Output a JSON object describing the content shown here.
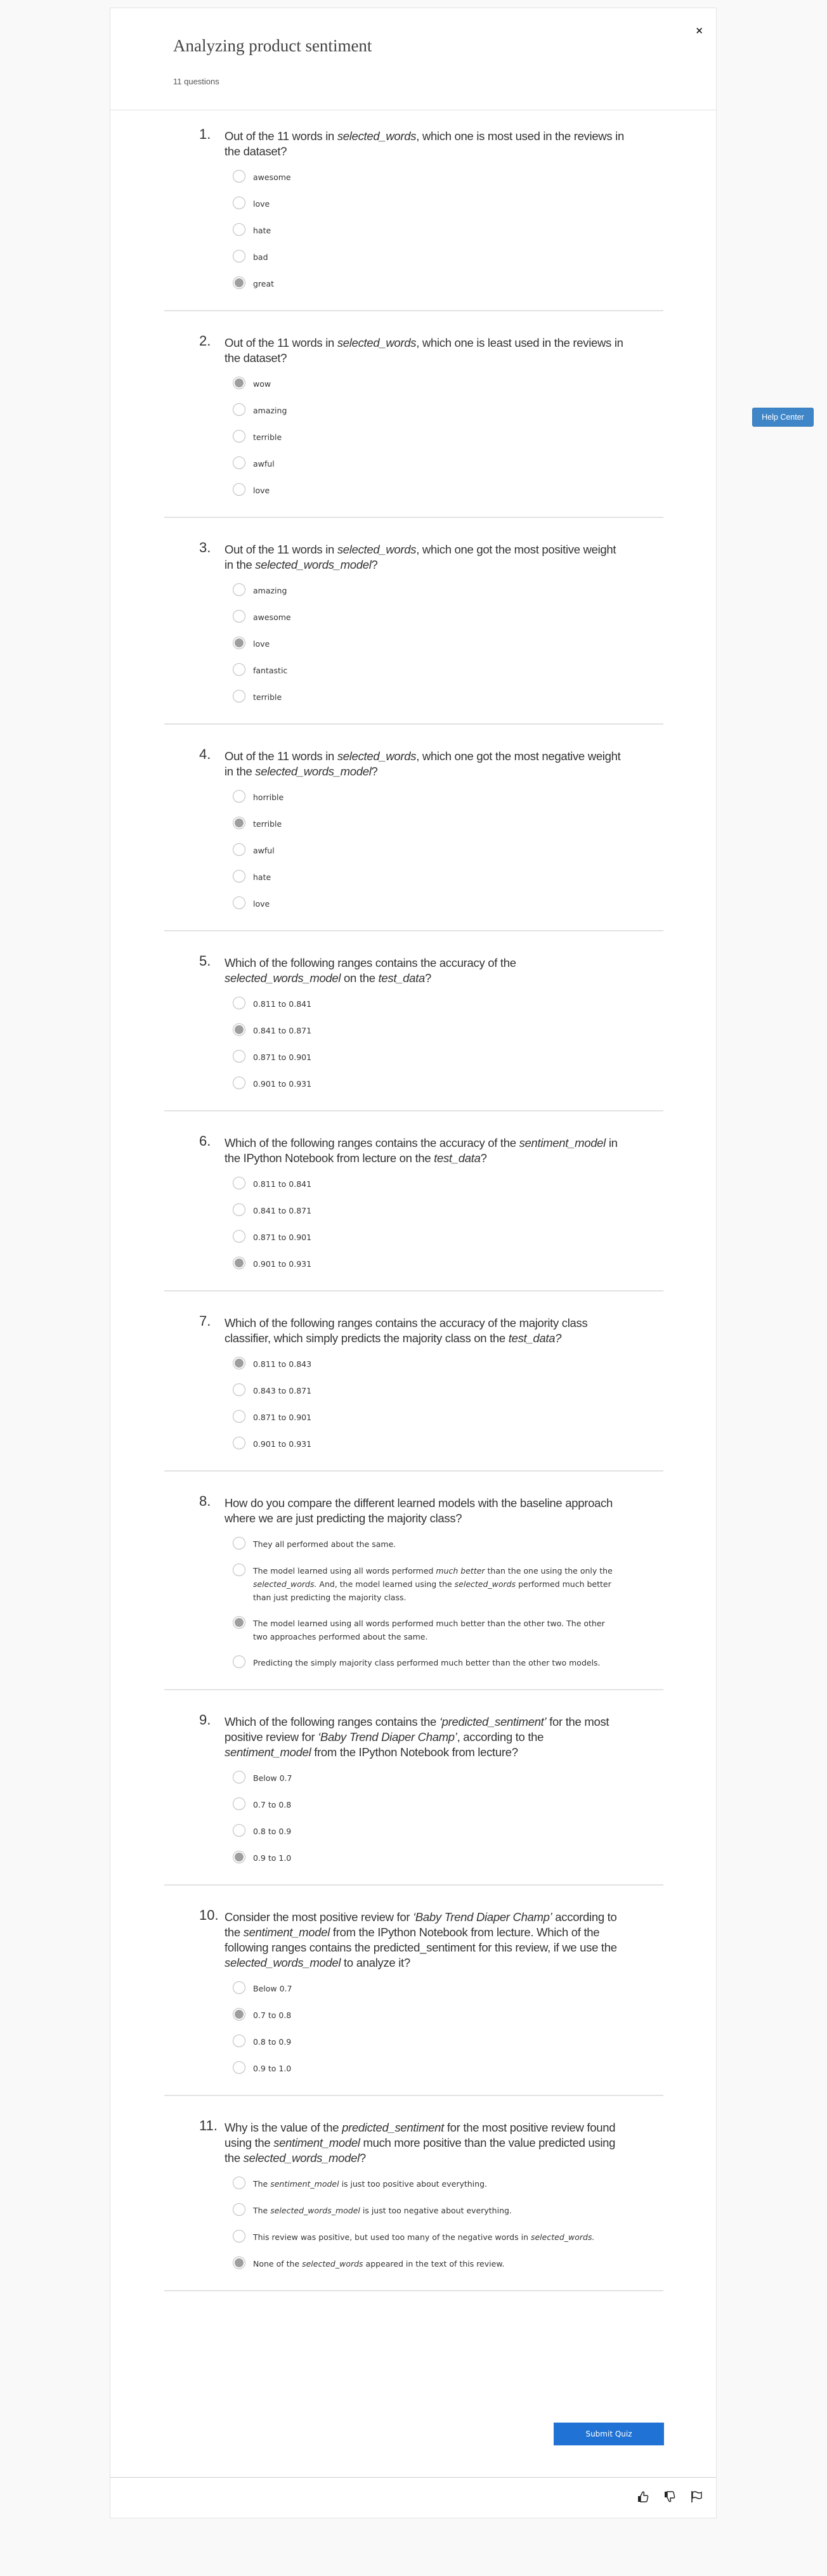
{
  "header": {
    "title": "Analyzing product sentiment",
    "question_count": "11 questions",
    "close_label": "×"
  },
  "help": {
    "label": "Help Center"
  },
  "questions": [
    {
      "number": "1.",
      "text_html": "Out of the 11 words in <i>selected_words</i>, which one is most used in the reviews in the dataset?",
      "options": [
        {
          "label_html": "awesome",
          "checked": false
        },
        {
          "label_html": "love",
          "checked": false
        },
        {
          "label_html": "hate",
          "checked": false
        },
        {
          "label_html": "bad",
          "checked": false
        },
        {
          "label_html": "great",
          "checked": true
        }
      ]
    },
    {
      "number": "2.",
      "text_html": "Out of the 11 words in <i>selected_words</i>, which one is least used in the reviews in the dataset?",
      "options": [
        {
          "label_html": "wow",
          "checked": true
        },
        {
          "label_html": "amazing",
          "checked": false
        },
        {
          "label_html": "terrible",
          "checked": false
        },
        {
          "label_html": "awful",
          "checked": false
        },
        {
          "label_html": "love",
          "checked": false
        }
      ]
    },
    {
      "number": "3.",
      "text_html": "Out of the 11 words in <i>selected_words</i>, which one got the most positive weight in the <i>selected_words_model</i>?",
      "options": [
        {
          "label_html": "amazing",
          "checked": false
        },
        {
          "label_html": "awesome",
          "checked": false
        },
        {
          "label_html": "love",
          "checked": true
        },
        {
          "label_html": "fantastic",
          "checked": false
        },
        {
          "label_html": "terrible",
          "checked": false
        }
      ]
    },
    {
      "number": "4.",
      "text_html": "Out of the 11 words in <i>selected_words</i>, which one got the most negative weight in the <i>selected_words_model</i>?",
      "options": [
        {
          "label_html": "horrible",
          "checked": false
        },
        {
          "label_html": "terrible",
          "checked": true
        },
        {
          "label_html": "awful",
          "checked": false
        },
        {
          "label_html": "hate",
          "checked": false
        },
        {
          "label_html": "love",
          "checked": false
        }
      ]
    },
    {
      "number": "5.",
      "text_html": "Which of the following ranges contains the accuracy of the <i>selected_words_model</i> on the <i>test_data</i>?",
      "options": [
        {
          "label_html": "0.811 to 0.841",
          "checked": false
        },
        {
          "label_html": "0.841 to 0.871",
          "checked": true
        },
        {
          "label_html": "0.871 to 0.901",
          "checked": false
        },
        {
          "label_html": "0.901 to 0.931",
          "checked": false
        }
      ]
    },
    {
      "number": "6.",
      "text_html": "Which of the following ranges contains the accuracy of the <i>sentiment_model</i> in the IPython Notebook from lecture on the <i>test_data</i>?",
      "options": [
        {
          "label_html": "0.811 to 0.841",
          "checked": false
        },
        {
          "label_html": "0.841 to 0.871",
          "checked": false
        },
        {
          "label_html": "0.871 to 0.901",
          "checked": false
        },
        {
          "label_html": "0.901 to 0.931",
          "checked": true
        }
      ]
    },
    {
      "number": "7.",
      "text_html": "Which of the following ranges contains the accuracy of the majority class classifier, which simply predicts the majority class on the <i>test_data?</i>",
      "options": [
        {
          "label_html": "0.811 to 0.843",
          "checked": true
        },
        {
          "label_html": "0.843 to 0.871",
          "checked": false
        },
        {
          "label_html": "0.871 to 0.901",
          "checked": false
        },
        {
          "label_html": "0.901 to 0.931",
          "checked": false
        }
      ]
    },
    {
      "number": "8.",
      "text_html": "How do you compare the different learned models with the baseline approach where we are just predicting the majority class?",
      "options": [
        {
          "label_html": "They all performed about the same.",
          "checked": false
        },
        {
          "label_html": "The model learned using all words performed <i>much better</i> than the one using the only the <i>selected_words.</i> And, the model learned using the <i>selected_words</i> performed much better than just predicting the majority class.",
          "checked": false
        },
        {
          "label_html": "The model learned using all words performed much better than the other two. The other two approaches performed about the same.",
          "checked": true
        },
        {
          "label_html": "Predicting the simply majority class performed much better than the other two models.",
          "checked": false
        }
      ]
    },
    {
      "number": "9.",
      "text_html": "Which of the following ranges contains the <i>‘predicted_sentiment’</i> for the most positive review for <i>‘Baby Trend Diaper Champ’</i>, according to the <i>sentiment_model</i> from the IPython Notebook from lecture?",
      "options": [
        {
          "label_html": "Below 0.7",
          "checked": false
        },
        {
          "label_html": "0.7 to 0.8",
          "checked": false
        },
        {
          "label_html": "0.8 to 0.9",
          "checked": false
        },
        {
          "label_html": "0.9 to 1.0",
          "checked": true
        }
      ]
    },
    {
      "number": "10.",
      "text_html": "Consider the most positive review for <i>‘Baby Trend Diaper Champ’</i> according to the <i>sentiment_model</i> from the IPython Notebook from lecture. Which of the following ranges contains the predicted_sentiment for this review, if we use the <i>selected_words_model</i> to analyze it?",
      "options": [
        {
          "label_html": "Below 0.7",
          "checked": false
        },
        {
          "label_html": "0.7 to 0.8",
          "checked": true
        },
        {
          "label_html": "0.8 to 0.9",
          "checked": false
        },
        {
          "label_html": "0.9 to 1.0",
          "checked": false
        }
      ]
    },
    {
      "number": "11.",
      "text_html": "Why is the value of the <i>predicted_sentiment</i> for the most positive review found using the <i>sentiment_model</i> much more positive than the value predicted using the <i>selected_words_model</i>?",
      "options": [
        {
          "label_html": "The <i>sentiment_model</i> is just too positive about everything.",
          "checked": false
        },
        {
          "label_html": "The <i>selected_words_model</i> is just too negative about everything.",
          "checked": false
        },
        {
          "label_html": "This review was positive, but used too many of the negative words in <i>selected_words.</i>",
          "checked": false
        },
        {
          "label_html": "None of the <i>selected_words</i> appeared in the text of this review.",
          "checked": true
        }
      ]
    }
  ],
  "submit": {
    "label": "Submit Quiz"
  },
  "footer": {
    "icons": [
      "thumbs-up-icon",
      "thumbs-down-icon",
      "flag-icon"
    ]
  },
  "colors": {
    "accent": "#2073d4",
    "help_button": "#3f86c9",
    "radio_checked": "#9e9e9e",
    "background": "#f9f9f9"
  }
}
